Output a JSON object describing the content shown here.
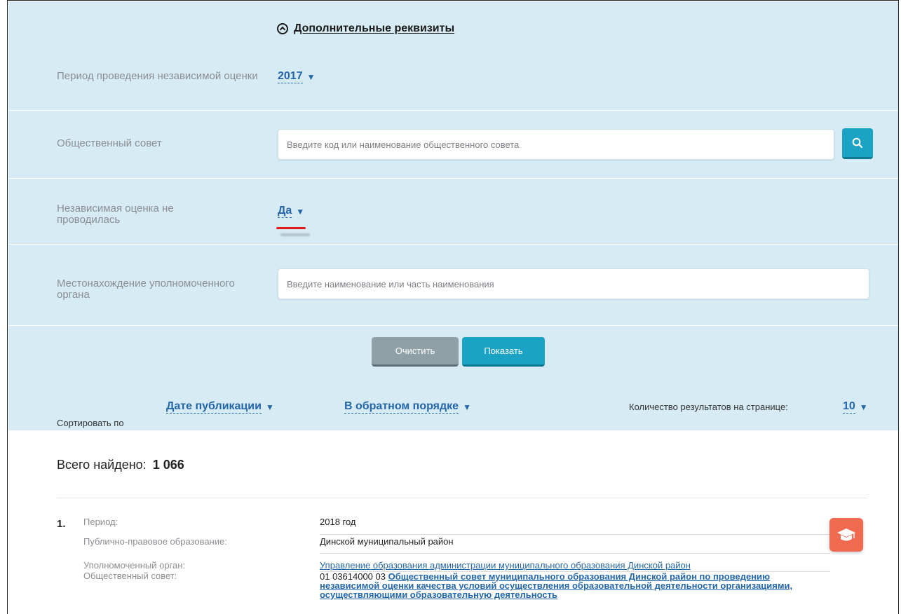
{
  "filters": {
    "extra_requisites_label": "Дополнительные реквизиты",
    "period": {
      "label": "Период проведения независимой оценки",
      "value": "2017"
    },
    "council": {
      "label": "Общественный совет",
      "placeholder": "Введите код или наименование общественного совета"
    },
    "not_conducted": {
      "label": "Независимая оценка не проводилась",
      "value": "Да"
    },
    "location": {
      "label": "Местонахождение уполномоченного органа",
      "placeholder": "Введите наименование или часть наименования"
    },
    "buttons": {
      "clear": "Очистить",
      "show": "Показать"
    }
  },
  "sort": {
    "label": "Сортировать по",
    "field": "Дате публикации",
    "order": "В обратном порядке",
    "per_page_label": "Количество результатов на странице:",
    "per_page_value": "10"
  },
  "results": {
    "total_label": "Всего найдено:",
    "total_value": "1 066",
    "items": [
      {
        "number": "1.",
        "period_label": "Период:",
        "period_value": "2018 год",
        "entity_label": "Публично-правовое образование:",
        "entity_value": "Динской муниципальный район",
        "authority_label": "Уполномоченный орган:",
        "authority_value": "Управление образования администрации муниципального образования Динской район",
        "council_label": "Общественный совет:",
        "council_code": "01 03614000 03",
        "council_value": "Общественный совет муниципального образования Динской район по проведению независимой оценки качества условий осуществления образовательной деятельности организациями, осуществляющими образовательную деятельность"
      }
    ]
  },
  "colors": {
    "panel_bg": "#d6ebf4",
    "accent": "#1aa3c4",
    "link": "#2466a8",
    "clear_btn": "#8fa1a6",
    "badge": "#ef6a4e",
    "highlight": "#e01b1b"
  },
  "icons": {
    "extra_toggle": "chevron-up-circle-icon",
    "search": "search-icon",
    "dropdown": "triangle-down-icon",
    "badge": "graduation-cap-icon"
  }
}
